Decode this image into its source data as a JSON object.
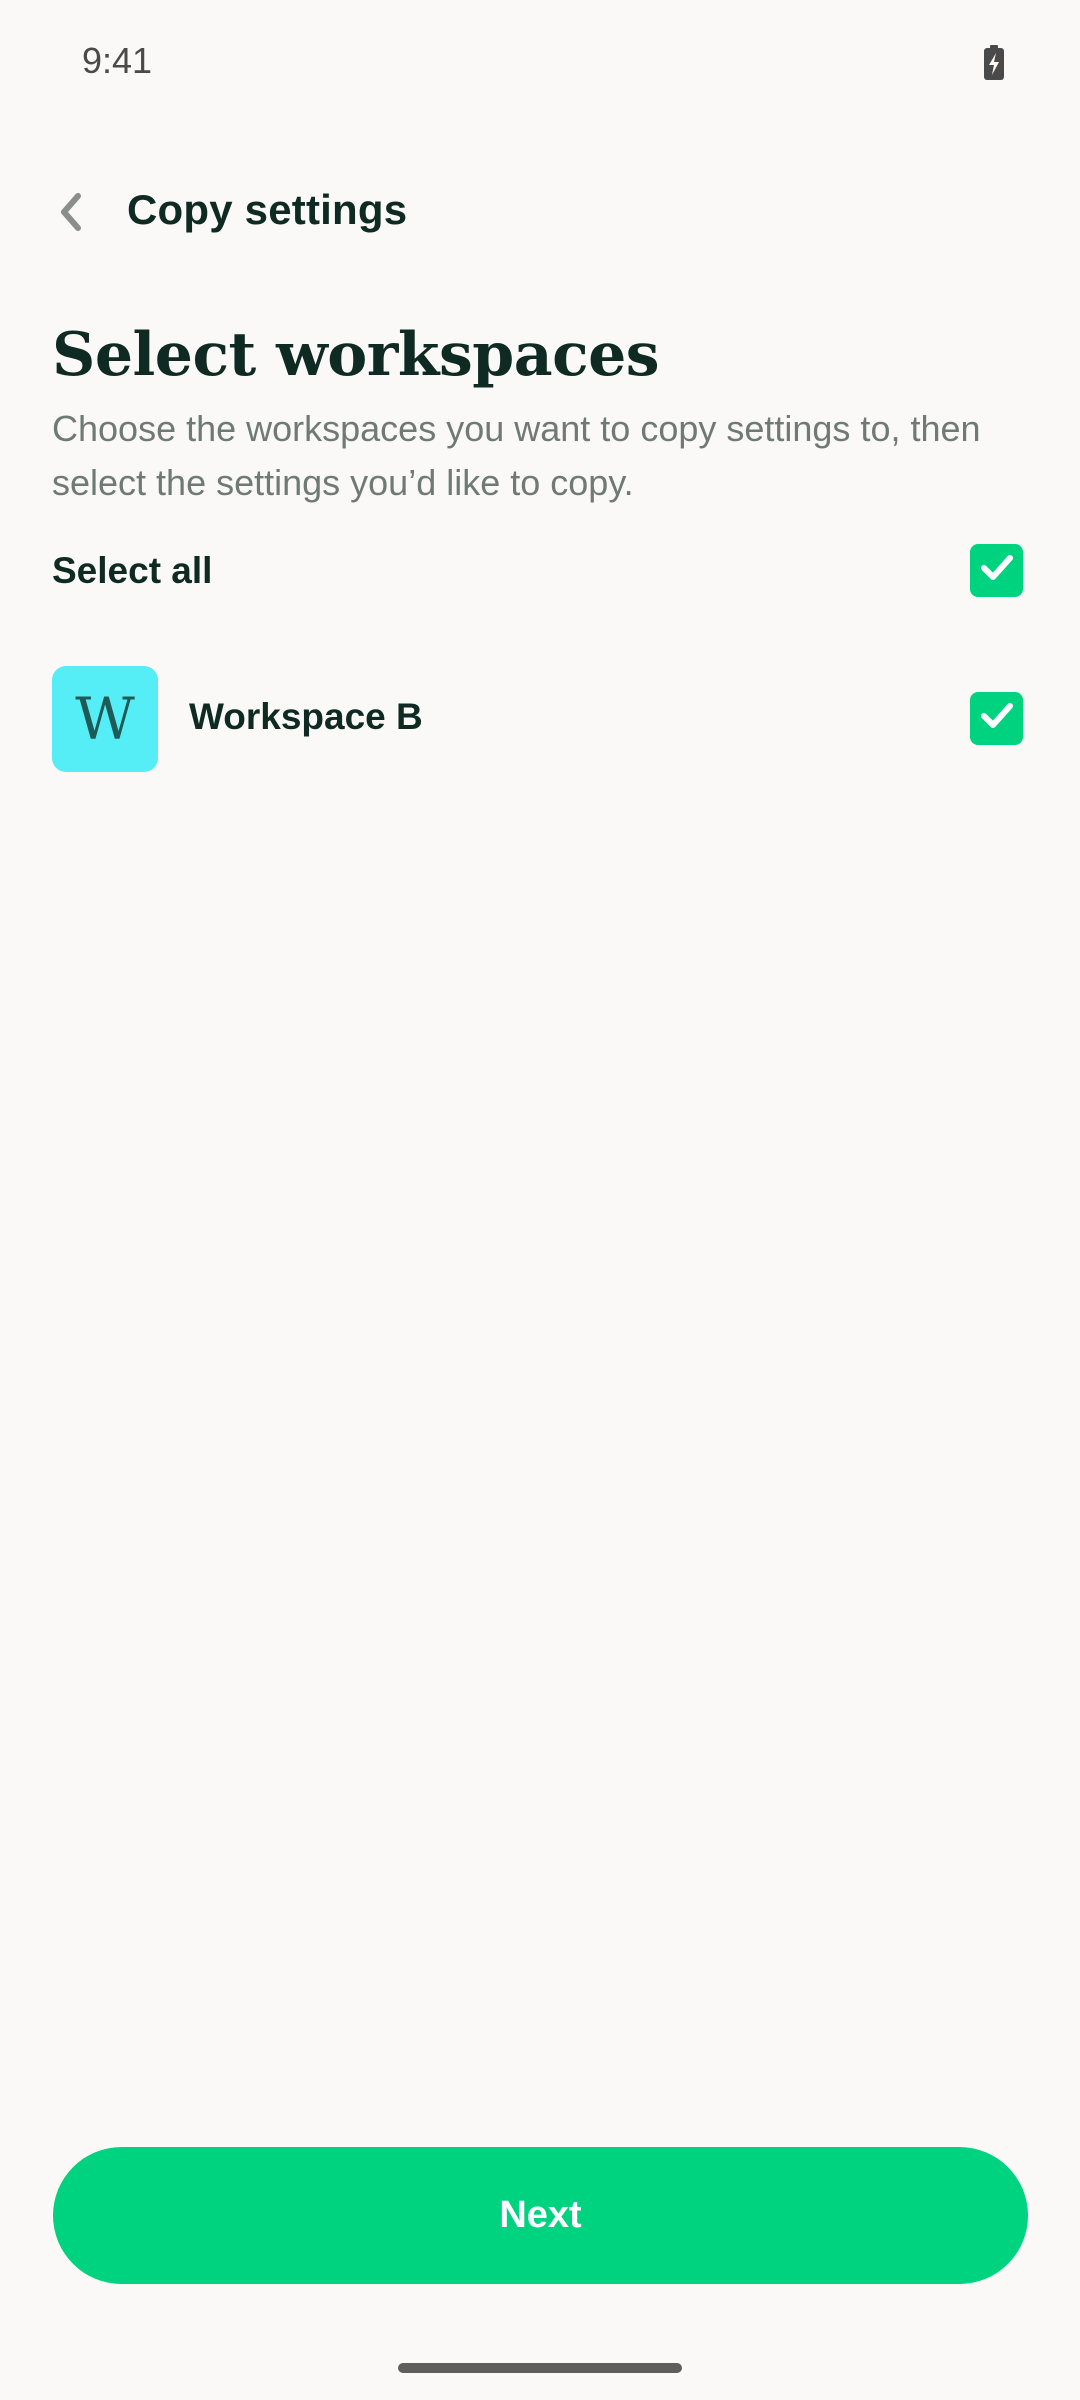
{
  "status_bar": {
    "time": "9:41",
    "battery_icon": "battery-charging-icon"
  },
  "app_bar": {
    "back_icon": "chevron-left-icon",
    "title": "Copy settings"
  },
  "content": {
    "heading": "Select workspaces",
    "description": "Choose the workspaces you want to copy settings to, then select the settings you’d like to copy.",
    "select_all": {
      "label": "Select all",
      "checked": true
    },
    "workspaces": [
      {
        "avatar_letter": "W",
        "avatar_color": "#55EEF6",
        "name": "Workspace B",
        "checked": true
      }
    ]
  },
  "footer": {
    "next_label": "Next"
  },
  "colors": {
    "accent": "#00D37F",
    "text_primary": "#0F2A23",
    "text_secondary": "#6F7A76",
    "background": "#FAF9F7"
  }
}
